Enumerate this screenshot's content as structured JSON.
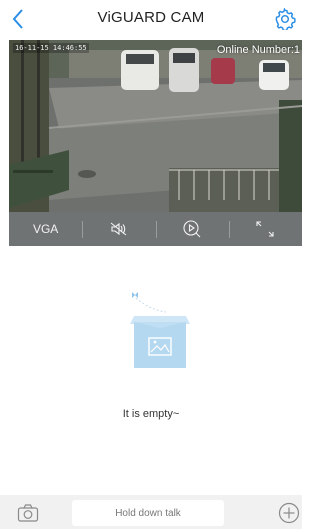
{
  "header": {
    "title": "ViGUARD CAM",
    "back_icon": "chevron-left-icon",
    "settings_icon": "gear-icon"
  },
  "video": {
    "timestamp": "16-11-15 14:46:55",
    "online_text": "Online Number:1"
  },
  "controls": {
    "resolution_label": "VGA",
    "mute_icon": "speaker-muted-icon",
    "playback_icon": "playback-search-icon",
    "fullscreen_icon": "expand-icon"
  },
  "empty_state": {
    "message": "It is empty~"
  },
  "bottom_bar": {
    "camera_icon": "camera-icon",
    "talk_label": "Hold down talk",
    "plus_icon": "plus-circle-icon"
  },
  "colors": {
    "accent": "#2b8ee6",
    "control_bar": "#707373",
    "bottom_bar": "#f1f1f1"
  }
}
